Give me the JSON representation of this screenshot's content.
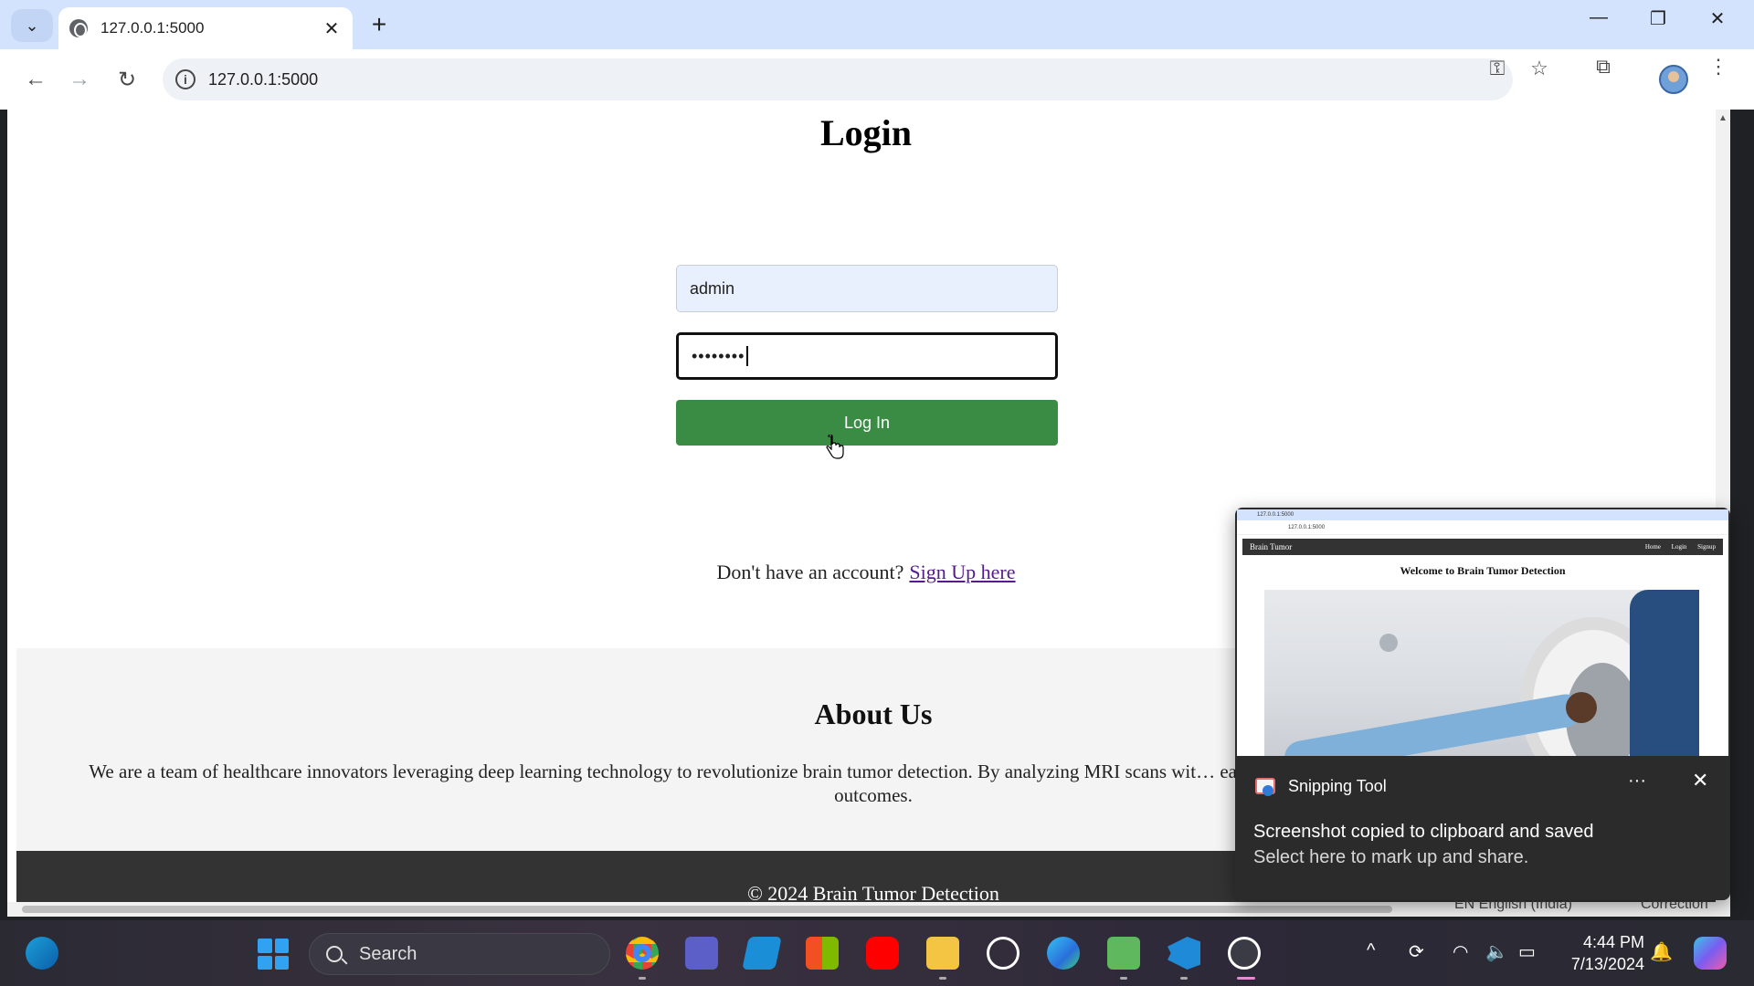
{
  "browser": {
    "tab_title": "127.0.0.1:5000",
    "url": "127.0.0.1:5000",
    "new_tab_symbol": "+",
    "tab_close_symbol": "✕"
  },
  "page": {
    "title": "Login",
    "username_value": "admin",
    "password_masked": "••••••••",
    "login_button": "Log In",
    "signup_prompt": "Don't have an account?",
    "signup_link": "Sign Up here",
    "about_title": "About Us",
    "about_text": "We are a team of healthcare innovators leveraging deep learning technology to revolutionize brain tumor detection. By analyzing MRI scans wit… early and accurate diagnosis, leading to improved patient outcomes.",
    "footer_text": "© 2024 Brain Tumor Detection"
  },
  "toast": {
    "app_name": "Snipping Tool",
    "message": "Screenshot copied to clipboard and saved",
    "sub_message": "Select here to mark up and share.",
    "more_symbol": "···",
    "close_symbol": "✕",
    "preview": {
      "tab": "127.0.0.1:5000",
      "url": "127.0.0.1:5000",
      "site_name": "Brain Tumor",
      "nav_links": "Home Login Signup",
      "welcome": "Welcome to Brain Tumor Detection"
    }
  },
  "status_peek": {
    "language": "EN English (India)",
    "correction": "Correction"
  },
  "taskbar": {
    "search_placeholder": "Search",
    "time": "4:44 PM",
    "date": "7/13/2024",
    "pinned_icons": [
      "start-icon",
      "chrome-icon",
      "teams-icon",
      "mail-icon",
      "store-icon",
      "youtube-icon",
      "file-explorer-icon",
      "dell-icon",
      "edge-icon",
      "paint-icon",
      "vscode-icon",
      "media-player-icon"
    ]
  },
  "colors": {
    "login_button": "#3a8c44",
    "username_fill": "#e8f0fe",
    "footer_bg": "#333333",
    "about_bg": "#f4f4f4",
    "link": "#551a8b",
    "tabstrip": "#d3e3fd"
  }
}
